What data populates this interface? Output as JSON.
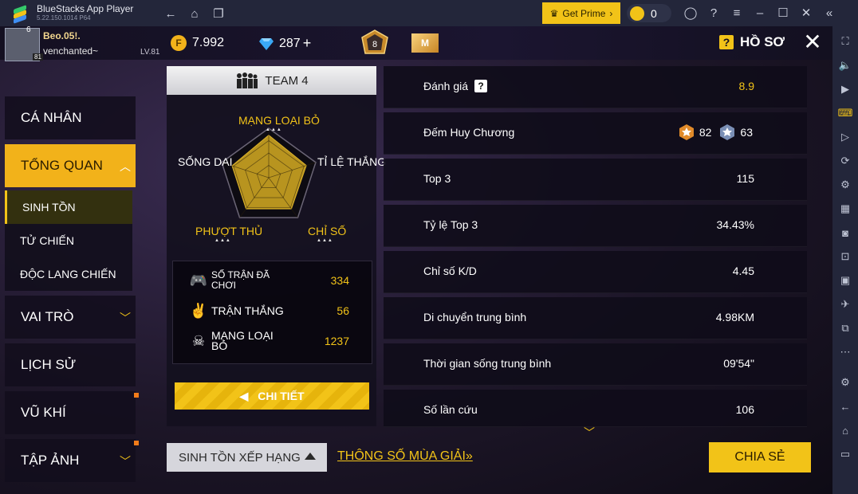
{
  "window": {
    "app_name": "BlueStacks App Player",
    "version": "5.22.150.1014  P64",
    "get_prime": "Get Prime",
    "coin_count": "0"
  },
  "player": {
    "name": "Beo.05!.",
    "subtitle": "venchanted~",
    "level": "LV.81",
    "badge_level": "6",
    "avatar_num": "81",
    "gold": "7.992",
    "diamonds": "287",
    "rank_number": "8",
    "m_badge": "M"
  },
  "header": {
    "profile_label": "HỒ SƠ"
  },
  "nav": {
    "ca_nhan": "CÁ NHÂN",
    "tong_quan": "TỔNG QUAN",
    "sub": [
      "SINH TỒN",
      "TỬ CHIẾN",
      "ĐỘC LANG CHIẾN"
    ],
    "vai_tro": "VAI TRÒ",
    "lich_su": "LỊCH SỬ",
    "vu_khi": "VŨ KHÍ",
    "tap_anh": "TẬP ẢNH"
  },
  "team": {
    "tab_label": "TEAM 4",
    "radar": {
      "labels": [
        "MẠNG LOẠI BỎ",
        "TỈ LỆ THẮNG",
        "CHỈ SỐ",
        "PHƯỢT THỦ",
        "SỐNG DAI"
      ],
      "values": [
        0.86,
        0.8,
        0.78,
        0.78,
        0.78
      ]
    },
    "stats": [
      {
        "label": "SỐ TRẬN ĐÃ CHƠI",
        "value": "334",
        "icon": "gamepad-icon"
      },
      {
        "label": "TRẬN THẮNG",
        "value": "56",
        "icon": "victory-hand-icon"
      },
      {
        "label": "MẠNG LOẠI BỎ",
        "value": "1237",
        "icon": "skull-icon"
      }
    ],
    "detail_button": "CHI TIẾT"
  },
  "overview": {
    "rows": [
      {
        "label": "Đánh giá",
        "value": "8.9"
      },
      {
        "label": "Đếm Huy Chương",
        "value": ""
      },
      {
        "label": "Top 3",
        "value": "115"
      },
      {
        "label": "Tỷ lệ Top 3",
        "value": "34.43%"
      },
      {
        "label": "Chỉ số K/D",
        "value": "4.45"
      },
      {
        "label": "Di chuyển trung bình",
        "value": "4.98KM"
      },
      {
        "label": "Thời gian sống trung bình",
        "value": "09'54\""
      },
      {
        "label": "Số lần cứu",
        "value": "106"
      }
    ],
    "medals": {
      "gold": "82",
      "silver": "63"
    }
  },
  "footer": {
    "mode_select": "SINH TỒN XẾP HẠNG",
    "season_link": "THÔNG SỐ MÙA GIẢI",
    "share_button": "CHIA SẺ"
  },
  "colors": {
    "accent": "#f2c318",
    "panel": "#14101e",
    "chrome": "#23263a"
  }
}
